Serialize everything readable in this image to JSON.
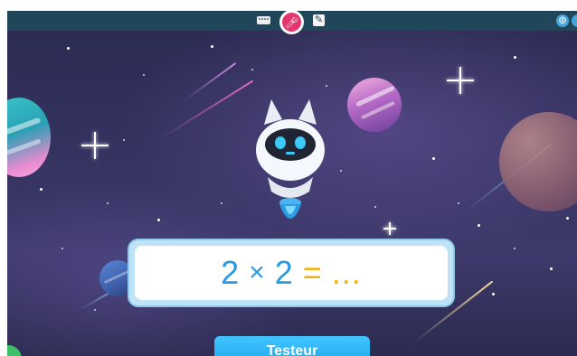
{
  "topbar": {
    "keyboard_icon": "keyboard-icon",
    "microphone_icon": "microphone-icon",
    "edit_icon": "pencil-square-icon",
    "globe_icon": "globe-icon",
    "colors": {
      "bar": "#20465a",
      "mic": "#e5356e"
    }
  },
  "exercise": {
    "operand1": "2",
    "operator": "×",
    "operand2": "2",
    "equals": "=",
    "answer_placeholder": "..."
  },
  "test_button": {
    "label": "Testeur"
  },
  "colors": {
    "number": "#2a9be0",
    "answer": "#f5b316",
    "button": "#1ca6ef",
    "space_bg": "#34325f"
  }
}
